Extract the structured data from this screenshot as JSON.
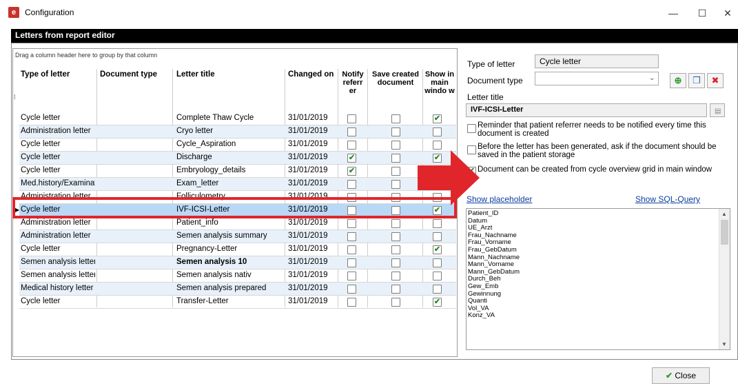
{
  "window": {
    "title": "Configuration",
    "minimize": "—",
    "maximize": "☐",
    "close": "✕"
  },
  "panel": {
    "title": "Letters from report editor",
    "group_hint": "Drag a column header here to group by that column"
  },
  "columns": {
    "type": "Type of letter",
    "doctype": "Document type",
    "title": "Letter title",
    "changed": "Changed on",
    "notify": "Notify referr er",
    "save": "Save created document",
    "show": "Show in main windo w"
  },
  "rows": [
    {
      "type": "Cycle letter",
      "doctype": "",
      "title": "Complete Thaw Cycle",
      "changed": "31/01/2019",
      "notify": false,
      "save": false,
      "show": true
    },
    {
      "type": "Administration letter",
      "doctype": "",
      "title": "Cryo letter",
      "changed": "31/01/2019",
      "notify": false,
      "save": false,
      "show": false
    },
    {
      "type": "Cycle letter",
      "doctype": "",
      "title": "Cycle_Aspiration",
      "changed": "31/01/2019",
      "notify": false,
      "save": false,
      "show": false
    },
    {
      "type": "Cycle letter",
      "doctype": "",
      "title": "Discharge",
      "changed": "31/01/2019",
      "notify": true,
      "save": false,
      "show": true
    },
    {
      "type": "Cycle letter",
      "doctype": "",
      "title": "Embryology_details",
      "changed": "31/01/2019",
      "notify": true,
      "save": false,
      "show": false
    },
    {
      "type": "Med.history/Examinat",
      "doctype": "",
      "title": "Exam_letter",
      "changed": "31/01/2019",
      "notify": false,
      "save": false,
      "show": false
    },
    {
      "type": "Administration letter",
      "doctype": "",
      "title": "Folliculometry",
      "changed": "31/01/2019",
      "notify": false,
      "save": false,
      "show": false
    },
    {
      "type": "Cycle letter",
      "doctype": "",
      "title": "IVF-ICSI-Letter",
      "changed": "31/01/2019",
      "notify": false,
      "save": false,
      "show": true
    },
    {
      "type": "Administration letter",
      "doctype": "",
      "title": "Patient_info",
      "changed": "31/01/2019",
      "notify": false,
      "save": false,
      "show": false
    },
    {
      "type": "Administration letter",
      "doctype": "",
      "title": "Semen analysis summary",
      "changed": "31/01/2019",
      "notify": false,
      "save": false,
      "show": false
    },
    {
      "type": "Cycle letter",
      "doctype": "",
      "title": "Pregnancy-Letter",
      "changed": "31/01/2019",
      "notify": false,
      "save": false,
      "show": true
    },
    {
      "type": "Semen analysis letter",
      "doctype": "",
      "title": "Semen analysis 10",
      "changed": "31/01/2019",
      "notify": false,
      "save": false,
      "show": false
    },
    {
      "type": "Semen analysis letter",
      "doctype": "",
      "title": "Semen analysis nativ",
      "changed": "31/01/2019",
      "notify": false,
      "save": false,
      "show": false
    },
    {
      "type": "Medical history letter",
      "doctype": "",
      "title": "Semen analysis prepared",
      "changed": "31/01/2019",
      "notify": false,
      "save": false,
      "show": false
    },
    {
      "type": "Cycle letter",
      "doctype": "",
      "title": "Transfer-Letter",
      "changed": "31/01/2019",
      "notify": false,
      "save": false,
      "show": true
    }
  ],
  "detail": {
    "type_label": "Type of letter",
    "type_value": "Cycle letter",
    "doctype_label": "Document type",
    "doctype_value": "",
    "title_label": "Letter title",
    "title_value": "IVF-ICSI-Letter",
    "opt_notify": "Reminder that patient referrer needs to be notified every time this document is created",
    "opt_save": "Before the letter has been generated, ask if the document should be saved in the patient storage",
    "opt_grid": "Document can be created from cycle overview grid in main window",
    "show_placeholder": "Show placeholder",
    "show_sql": "Show SQL-Query"
  },
  "placeholders": [
    "Patient_ID",
    "Datum",
    "UE_Arzt",
    "Frau_Nachname",
    "Frau_Vorname",
    "Frau_GebDatum",
    "Mann_Nachname",
    "Mann_Vorname",
    "Mann_GebDatum",
    "Durch_Beh",
    "Gew_Emb",
    "Gewinnung",
    "Quanti",
    "Vol_VA",
    "Konz_VA"
  ],
  "close_label": "Close"
}
